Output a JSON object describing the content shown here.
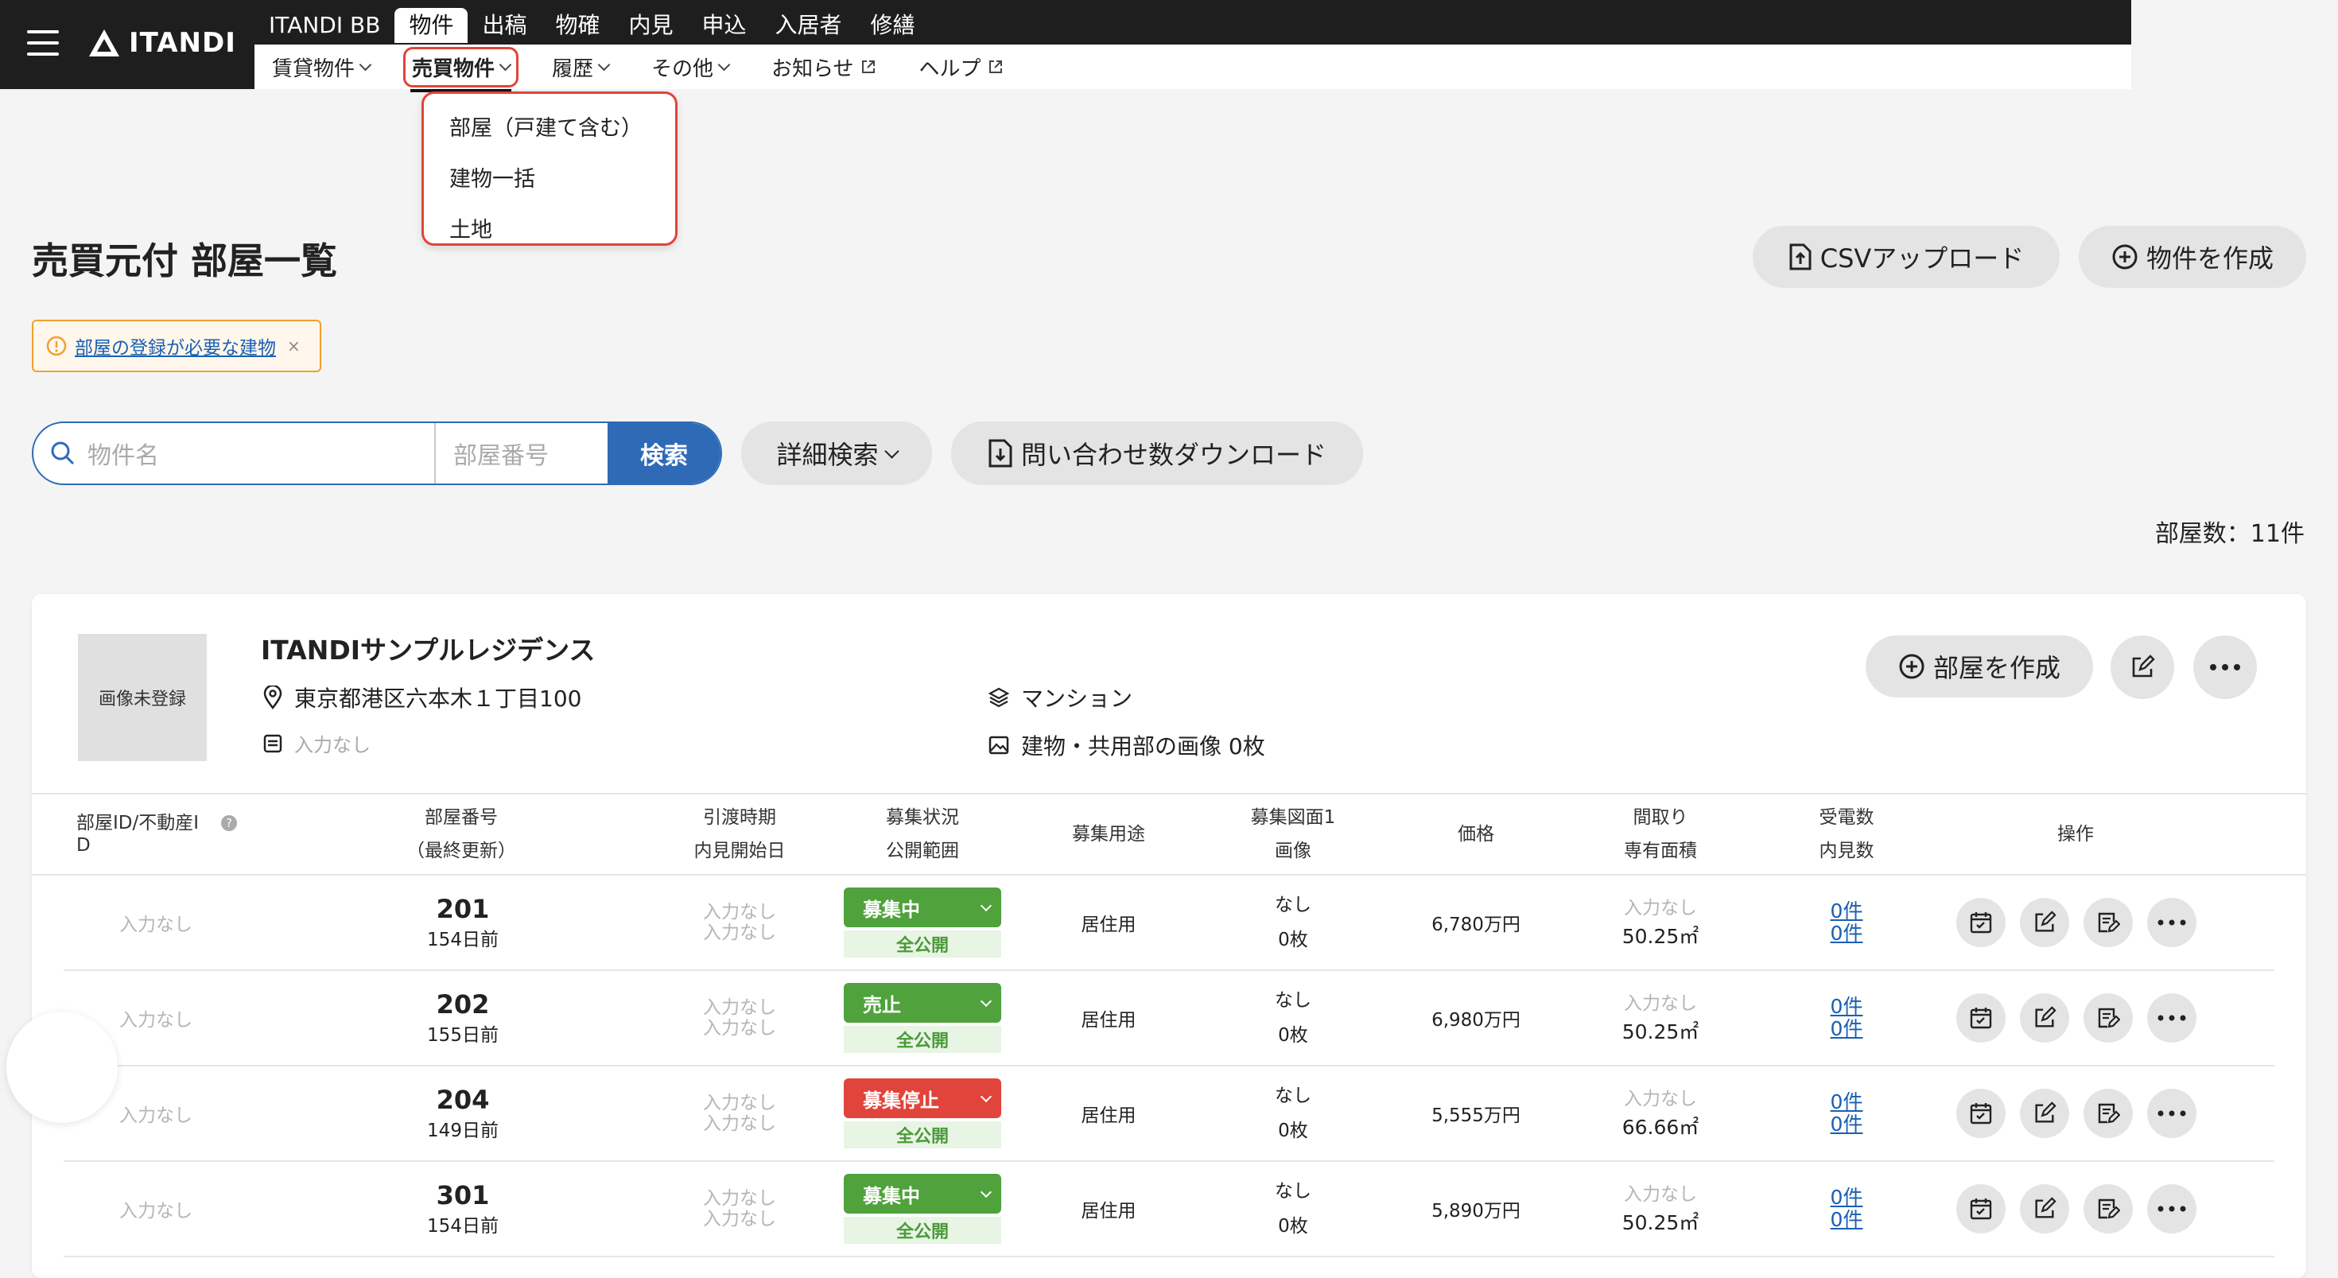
{
  "header": {
    "logo_text": "ITANDI",
    "nav_primary": [
      "ITANDI BB",
      "物件",
      "出稿",
      "物確",
      "内見",
      "申込",
      "入居者",
      "修繕"
    ],
    "nav_primary_active": "物件",
    "nav_secondary": {
      "rental": "賃貸物件",
      "sales": "売買物件",
      "history": "履歴",
      "other": "その他",
      "news": "お知らせ",
      "help": "ヘルプ"
    }
  },
  "dropdown": {
    "items": [
      "部屋（戸建て含む）",
      "建物一括",
      "土地"
    ]
  },
  "page": {
    "title": "売買元付 部屋一覧",
    "csv_upload": "CSVアップロード",
    "create_property": "物件を作成",
    "alert_link": "部屋の登録が必要な建物",
    "alert_close": "×",
    "search_name_placeholder": "物件名",
    "search_room_placeholder": "部屋番号",
    "search_button": "検索",
    "advanced_search": "詳細検索",
    "inquiry_download": "問い合わせ数ダウンロード",
    "room_count": "部屋数：11件"
  },
  "property": {
    "thumb_text": "画像未登録",
    "name": "ITANDIサンプルレジデンス",
    "address": "東京都港区六本木１丁目100",
    "memo": "入力なし",
    "type": "マンション",
    "images": "建物・共用部の画像 0枚",
    "create_room": "部屋を作成"
  },
  "table": {
    "headers": {
      "id": "部屋ID/不動産ID",
      "room_no": "部屋番号",
      "room_no_sub": "（最終更新）",
      "move": "引渡時期",
      "move_sub": "内見開始日",
      "status": "募集状況",
      "status_sub": "公開範囲",
      "usage": "募集用途",
      "drawing": "募集図面1",
      "drawing_sub": "画像",
      "price": "価格",
      "layout": "間取り",
      "layout_sub": "専有面積",
      "calls": "受電数",
      "calls_sub": "内見数",
      "ops": "操作"
    },
    "rows": [
      {
        "id": "入力なし",
        "room": "201",
        "updated": "154日前",
        "move": "入力なし",
        "preview": "入力なし",
        "status": "募集中",
        "status_color": "#4fa23c",
        "scope": "全公開",
        "usage": "居住用",
        "drawing": "なし",
        "images": "0枚",
        "price": "6,780万円",
        "layout": "入力なし",
        "area": "50.25㎡",
        "calls": "0件",
        "views": "0件"
      },
      {
        "id": "入力なし",
        "room": "202",
        "updated": "155日前",
        "move": "入力なし",
        "preview": "入力なし",
        "status": "売止",
        "status_color": "#4fa23c",
        "scope": "全公開",
        "usage": "居住用",
        "drawing": "なし",
        "images": "0枚",
        "price": "6,980万円",
        "layout": "入力なし",
        "area": "50.25㎡",
        "calls": "0件",
        "views": "0件"
      },
      {
        "id": "入力なし",
        "room": "204",
        "updated": "149日前",
        "move": "入力なし",
        "preview": "入力なし",
        "status": "募集停止",
        "status_color": "#e0443a",
        "scope": "全公開",
        "usage": "居住用",
        "drawing": "なし",
        "images": "0枚",
        "price": "5,555万円",
        "layout": "入力なし",
        "area": "66.66㎡",
        "calls": "0件",
        "views": "0件"
      },
      {
        "id": "入力なし",
        "room": "301",
        "updated": "154日前",
        "move": "入力なし",
        "preview": "入力なし",
        "status": "募集中",
        "status_color": "#4fa23c",
        "scope": "全公開",
        "usage": "居住用",
        "drawing": "なし",
        "images": "0枚",
        "price": "5,890万円",
        "layout": "入力なし",
        "area": "50.25㎡",
        "calls": "0件",
        "views": "0件"
      }
    ]
  }
}
